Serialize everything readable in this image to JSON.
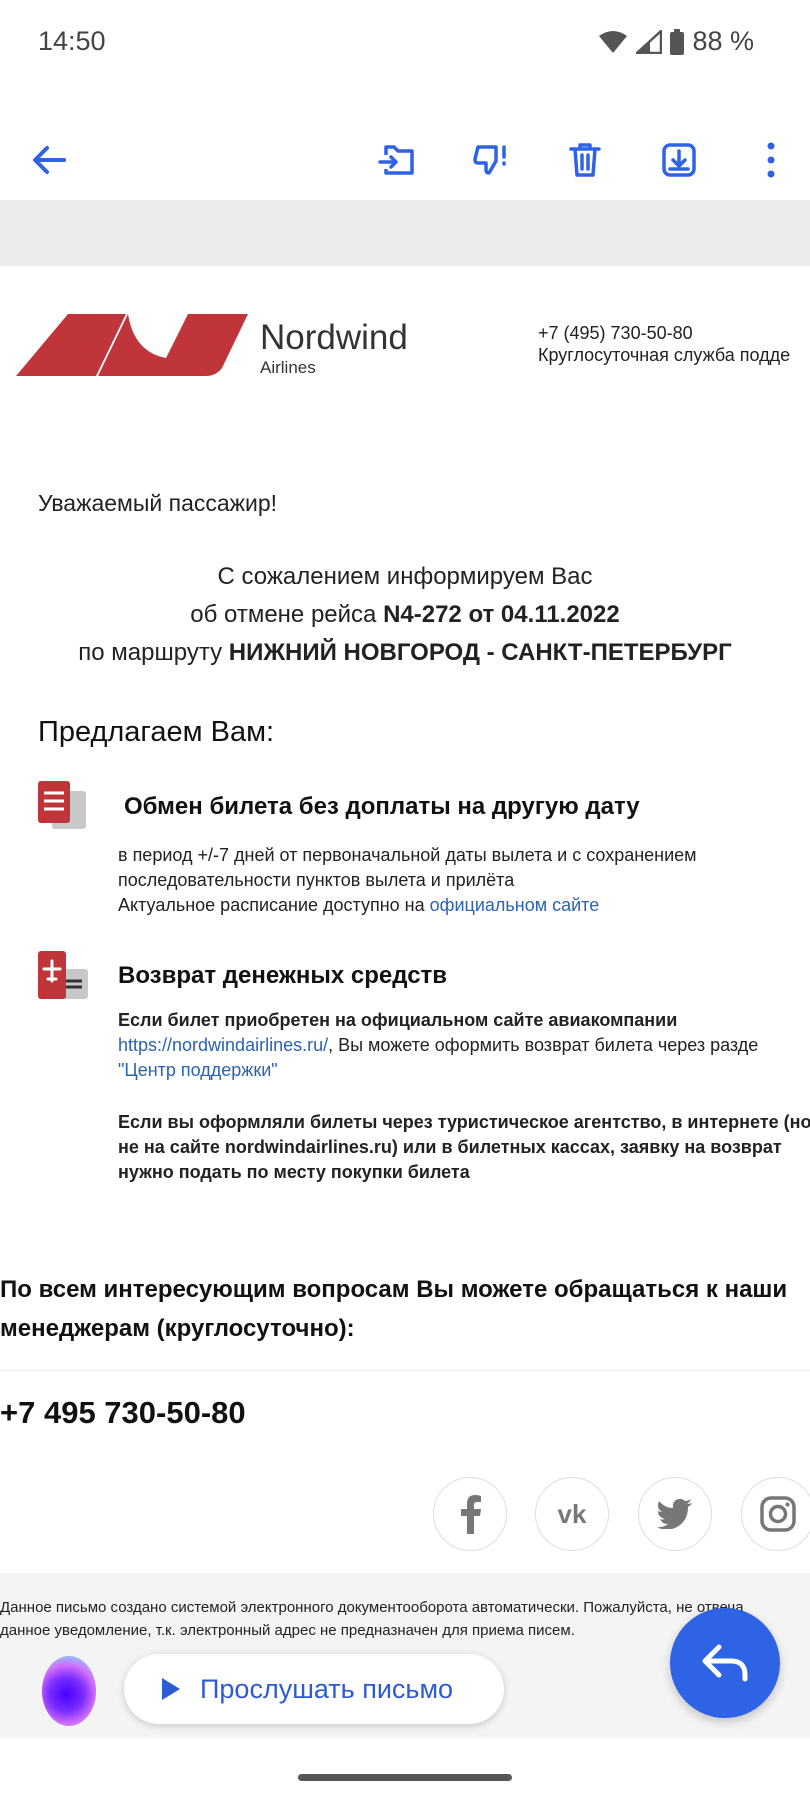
{
  "status_bar": {
    "time": "14:50",
    "battery": "88 %"
  },
  "toolbar": {
    "icons": [
      "back-arrow-icon",
      "move-to-icon",
      "report-spam-icon",
      "delete-icon",
      "archive-icon",
      "more-icon"
    ],
    "accent": "#2f63e6"
  },
  "email": {
    "brand": {
      "name": "Nordwind",
      "sub": "Airlines",
      "color": "#c0353a"
    },
    "contact": {
      "phone": "+7 (495) 730-50-80",
      "service": "Круглосуточная служба подде"
    },
    "greeting": "Уважаемый пассажир!",
    "notice": {
      "line1": "С сожалением информируем Вас",
      "line2_prefix": "об отмене рейса ",
      "line2_bold": "N4-272 от 04.11.2022",
      "line3_prefix": "по маршруту ",
      "line3_bold": "НИЖНИЙ НОВГОРОД - САНКТ-ПЕТЕРБУРГ"
    },
    "offer_heading": "Предлагаем Вам:",
    "options": [
      {
        "title": "Обмен билета без доплаты на другую дату",
        "line1": "в период +/-7 дней от первоначальной даты вылета и с сохранением",
        "line2": "последовательности пунктов вылета и прилёта",
        "line3_prefix": "Актуальное расписание доступно на ",
        "line3_link": "официальном сайте"
      },
      {
        "title": "Возврат денежных средств",
        "para1_line1": "Если билет приобретен на официальном сайте авиакомпании",
        "para1_link": "https://nordwindairlines.ru/",
        "para1_line2_rest": ", Вы можете оформить возврат билета через разде",
        "para1_link2": "\"Центр поддержки\"",
        "para2_line1": "Если вы оформляли билеты через туристическое агентство, в интернете (но",
        "para2_line2": "не на сайте nordwindairlines.ru) или в билетных кассах, заявку на возврат",
        "para2_line3": "нужно подать по месту покупки билета"
      }
    ],
    "questions_line1": "По всем интересующим вопросам Вы можете обращаться к наши",
    "questions_line2": "менеджерам (круглосуточно):",
    "phone": "+7 495 730-50-80",
    "socials": [
      "facebook-icon",
      "vk-icon",
      "twitter-icon",
      "instagram-icon"
    ],
    "footer_line1": "Данное письмо создано системой электронного документооборота автоматически. Пожалуйста, не отвеча",
    "footer_line2": "данное уведомление, т.к. электронный адрес не предназначен для приема писем."
  },
  "assistant": {
    "listen_label": "Прослушать письмо"
  }
}
